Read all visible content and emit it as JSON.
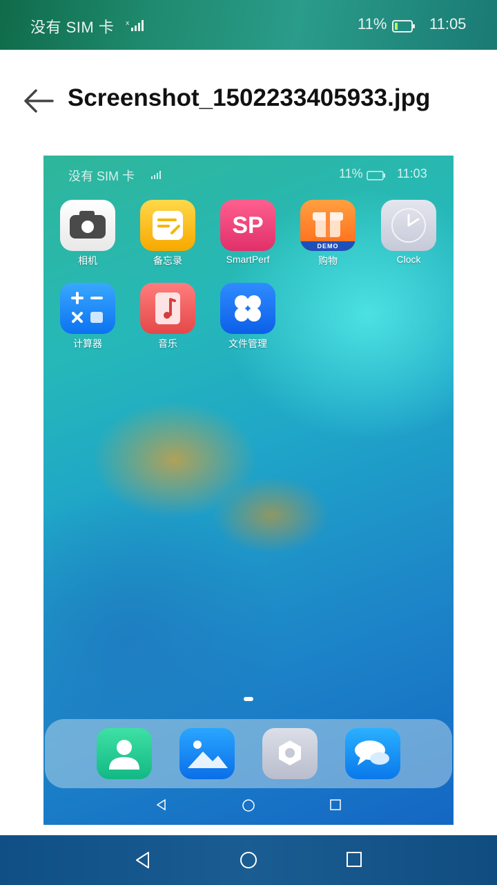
{
  "status_bar": {
    "carrier": "没有 SIM 卡",
    "battery_percent": "11%",
    "time": "11:05"
  },
  "header": {
    "title": "Screenshot_1502233405933.jpg"
  },
  "preview": {
    "status_bar": {
      "carrier": "没有 SIM 卡",
      "battery_percent": "11%",
      "time": "11:03"
    },
    "apps": [
      {
        "label": "相机",
        "icon": "camera-icon"
      },
      {
        "label": "备忘录",
        "icon": "notes-icon"
      },
      {
        "label": "SmartPerf",
        "icon": "smartperf-icon",
        "icon_text": "SP"
      },
      {
        "label": "购物",
        "icon": "shopping-icon",
        "badge": "DEMO"
      },
      {
        "label": "Clock",
        "icon": "clock-icon"
      },
      {
        "label": "计算器",
        "icon": "calculator-icon"
      },
      {
        "label": "音乐",
        "icon": "music-icon"
      },
      {
        "label": "文件管理",
        "icon": "file-manager-icon"
      }
    ],
    "dock": [
      "contacts-icon",
      "gallery-icon",
      "settings-icon",
      "messages-icon"
    ]
  },
  "colors": {
    "accent_green": "#1f8a6e",
    "nav_blue": "#1a5d92",
    "title_text": "#111111"
  }
}
